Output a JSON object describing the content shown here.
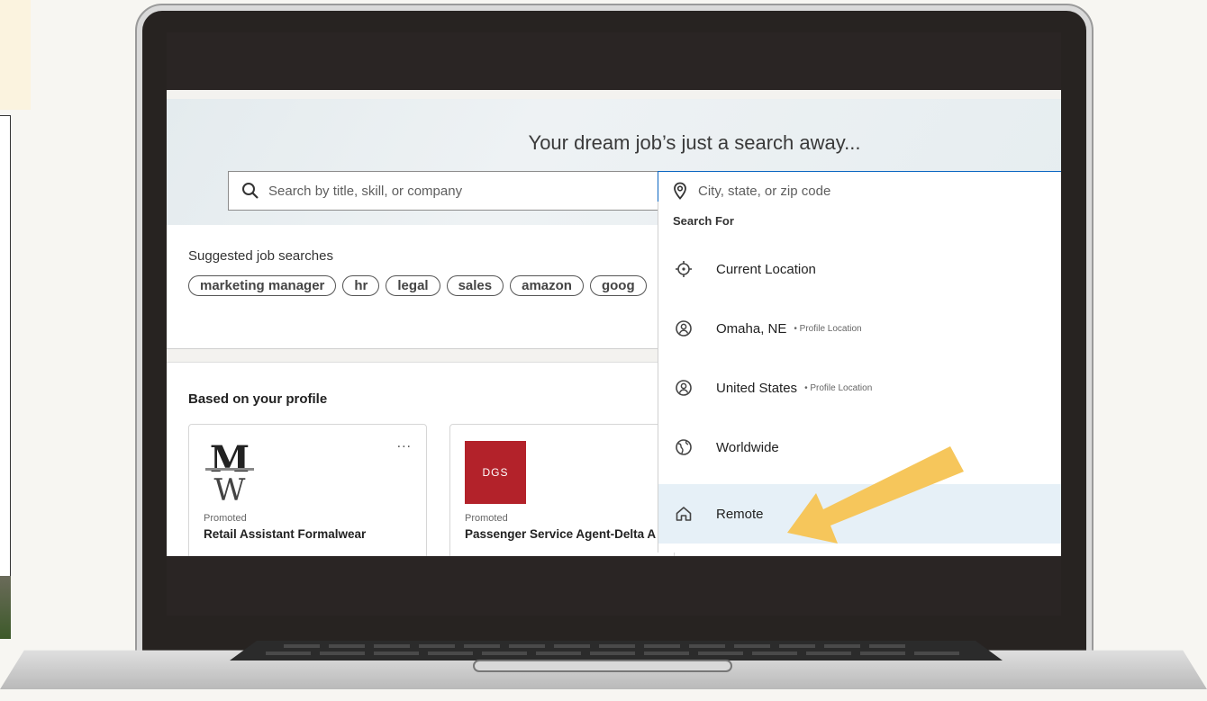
{
  "hero": {
    "title": "Your dream job’s just a search away..."
  },
  "search": {
    "title_placeholder": "Search by title, skill, or company",
    "location_placeholder": "City, state, or zip code"
  },
  "suggested": {
    "title": "Suggested job searches",
    "chips": [
      "marketing manager",
      "hr",
      "legal",
      "sales",
      "amazon",
      "goog"
    ]
  },
  "profile": {
    "title": "Based on your profile",
    "jobs": [
      {
        "promoted": "Promoted",
        "title": "Retail Assistant Formalwear",
        "more": "..."
      },
      {
        "promoted": "Promoted",
        "title": "Passenger Service Agent-Delta A",
        "logo_text": "DGS"
      }
    ]
  },
  "dropdown": {
    "header": "Search For",
    "items": [
      {
        "label": "Current Location",
        "sub": "",
        "icon": "crosshair-icon"
      },
      {
        "label": "Omaha, NE",
        "sub": "• Profile Location",
        "icon": "profile-location-icon"
      },
      {
        "label": "United States",
        "sub": "• Profile Location",
        "icon": "profile-location-icon"
      },
      {
        "label": "Worldwide",
        "sub": "",
        "icon": "globe-icon"
      },
      {
        "label": "Remote",
        "sub": "",
        "icon": "home-icon"
      }
    ]
  },
  "colors": {
    "accent": "#0a66c2",
    "arrow": "#f6c65b",
    "highlight": "#e6f0f7"
  }
}
